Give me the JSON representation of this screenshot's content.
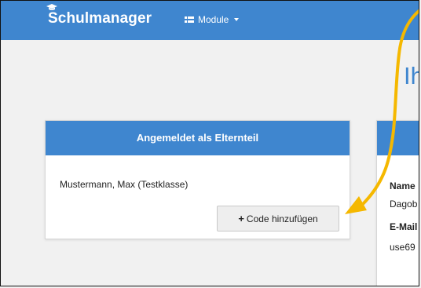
{
  "navbar": {
    "brand": "Schulmanager",
    "module_label": "Module"
  },
  "page": {
    "heading_partial": "Ih"
  },
  "login_card": {
    "title": "Angemeldet als Elternteil",
    "student": "Mustermann, Max (Testklasse)",
    "add_code_label": "Code hinzufügen"
  },
  "profile_card": {
    "name_label": "Name",
    "name_value": "Dagob",
    "email_label": "E-Mail",
    "email_value": "use69"
  },
  "colors": {
    "primary": "#3f86cf",
    "annotation_arrow": "#f5b800"
  },
  "icons": [
    "graduation-cap-icon",
    "grid-icon",
    "caret-down-icon",
    "plus-icon"
  ]
}
